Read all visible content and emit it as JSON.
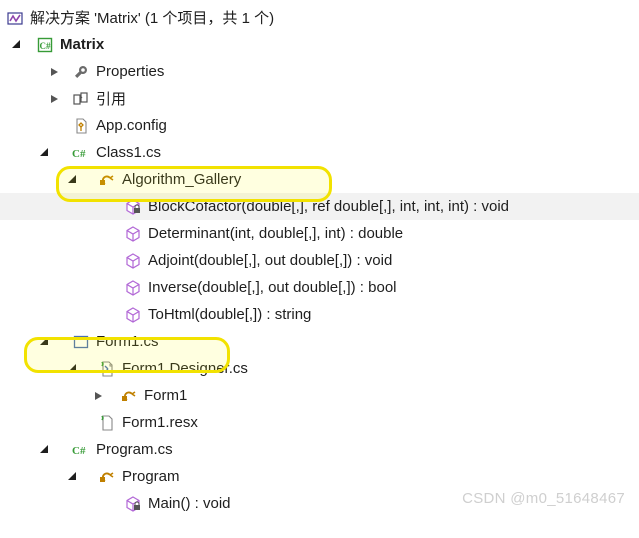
{
  "solution": {
    "label": "解决方案 'Matrix' (1 个项目，共 1 个)"
  },
  "project": {
    "name": "Matrix",
    "properties": "Properties",
    "references": "引用",
    "appconfig": "App.config",
    "class1": {
      "file": "Class1.cs",
      "class": "Algorithm_Gallery",
      "members": [
        "BlockCofactor(double[,], ref double[,], int, int, int) : void",
        "Determinant(int, double[,], int) : double",
        "Adjoint(double[,], out double[,]) : void",
        "Inverse(double[,], out double[,]) : bool",
        "ToHtml(double[,]) : string"
      ]
    },
    "form1": {
      "file": "Form1.cs",
      "designer": "Form1.Designer.cs",
      "class": "Form1",
      "resx": "Form1.resx"
    },
    "program": {
      "file": "Program.cs",
      "class": "Program",
      "main": "Main() : void"
    }
  },
  "watermark": "CSDN @m0_51648467"
}
